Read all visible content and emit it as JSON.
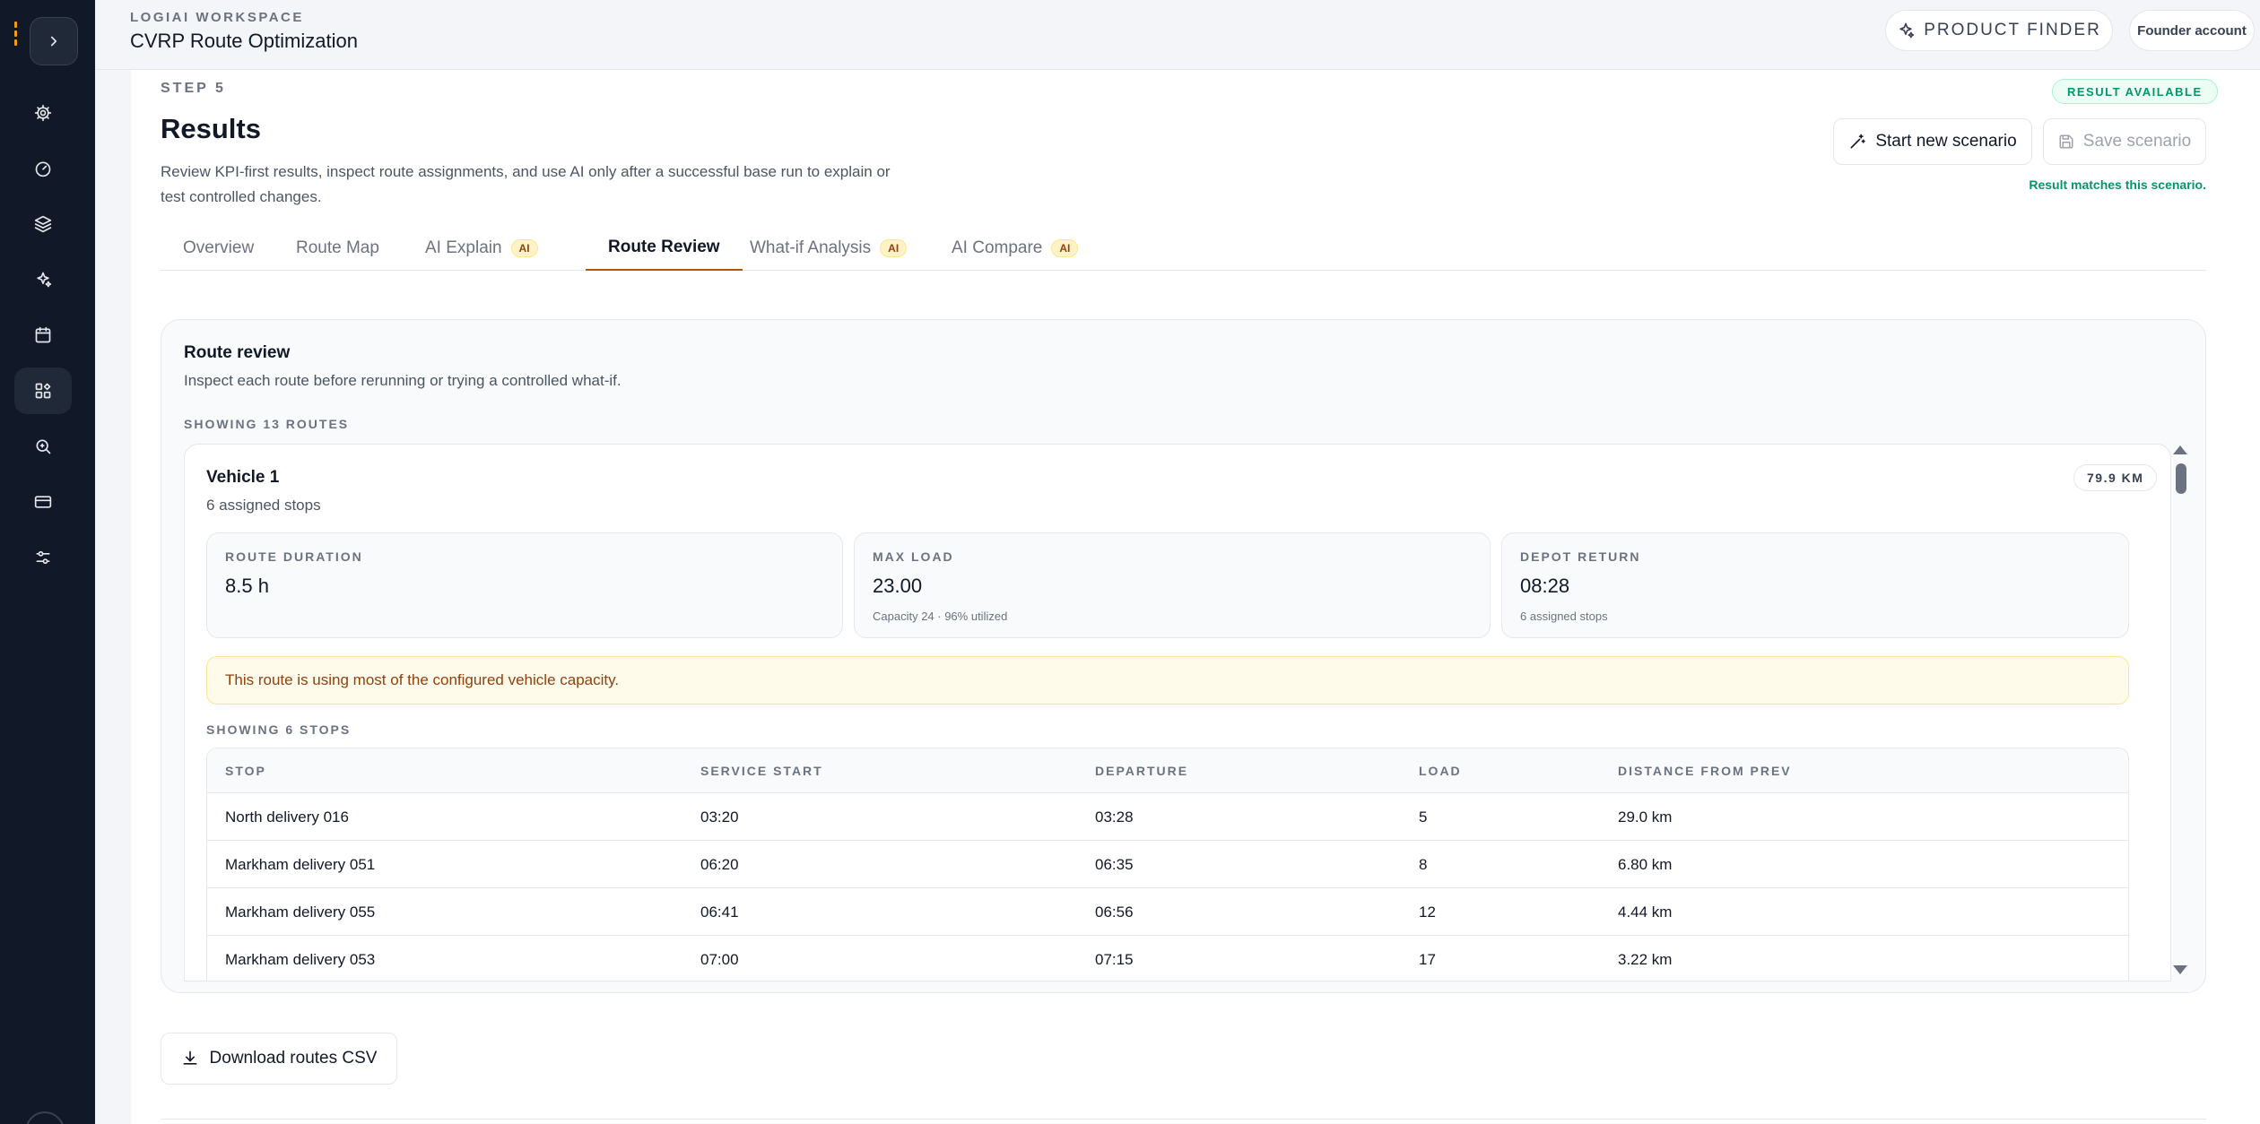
{
  "topbar": {
    "workspace_label": "LOGIAI WORKSPACE",
    "app_title": "CVRP Route Optimization",
    "product_finder_label": "PRODUCT FINDER",
    "account_label": "Founder account"
  },
  "sidebar": {
    "items": [
      {
        "icon": "settings-icon"
      },
      {
        "icon": "gauge-icon"
      },
      {
        "icon": "layers-icon"
      },
      {
        "icon": "sparkles-icon"
      },
      {
        "icon": "calendar-icon"
      },
      {
        "icon": "widgets-icon",
        "active": true
      },
      {
        "icon": "ai-analytics-icon"
      },
      {
        "icon": "credit-card-icon"
      },
      {
        "icon": "sliders-icon"
      }
    ]
  },
  "header": {
    "step_label": "STEP 5",
    "title": "Results",
    "description": "Review KPI-first results, inspect route assignments, and use AI only after a successful base run to explain or test controlled changes.",
    "status_badge": "RESULT AVAILABLE",
    "new_scenario_label": "Start new scenario",
    "save_scenario_label": "Save scenario",
    "match_note": "Result matches this scenario."
  },
  "tabs": [
    {
      "label": "Overview",
      "ai": false
    },
    {
      "label": "Route Map",
      "ai": false
    },
    {
      "label": "AI Explain",
      "ai": true
    },
    {
      "label": "Route Review",
      "ai": false,
      "active": true
    },
    {
      "label": "What-if Analysis",
      "ai": true
    },
    {
      "label": "AI Compare",
      "ai": true
    }
  ],
  "ai_badge_label": "AI",
  "review": {
    "title": "Route review",
    "subtitle": "Inspect each route before rerunning or trying a controlled what-if.",
    "showing_routes": "SHOWING 13 ROUTES",
    "vehicle": {
      "name": "Vehicle 1",
      "stops_summary": "6 assigned stops",
      "distance": "79.9 KM",
      "stats": [
        {
          "label": "ROUTE DURATION",
          "value": "8.5 h",
          "note": ""
        },
        {
          "label": "MAX LOAD",
          "value": "23.00",
          "note": "Capacity 24 · 96% utilized"
        },
        {
          "label": "DEPOT RETURN",
          "value": "08:28",
          "note": "6 assigned stops"
        }
      ],
      "warning": "This route is using most of the configured vehicle capacity.",
      "showing_stops": "SHOWING 6 STOPS",
      "columns": [
        "STOP",
        "SERVICE START",
        "DEPARTURE",
        "LOAD",
        "DISTANCE FROM PREV"
      ],
      "rows": [
        [
          "North delivery 016",
          "03:20",
          "03:28",
          "5",
          "29.0 km"
        ],
        [
          "Markham delivery 051",
          "06:20",
          "06:35",
          "8",
          "6.80 km"
        ],
        [
          "Markham delivery 055",
          "06:41",
          "06:56",
          "12",
          "4.44 km"
        ],
        [
          "Markham delivery 053",
          "07:00",
          "07:15",
          "17",
          "3.22 km"
        ]
      ]
    }
  },
  "download_label": "Download routes CSV"
}
